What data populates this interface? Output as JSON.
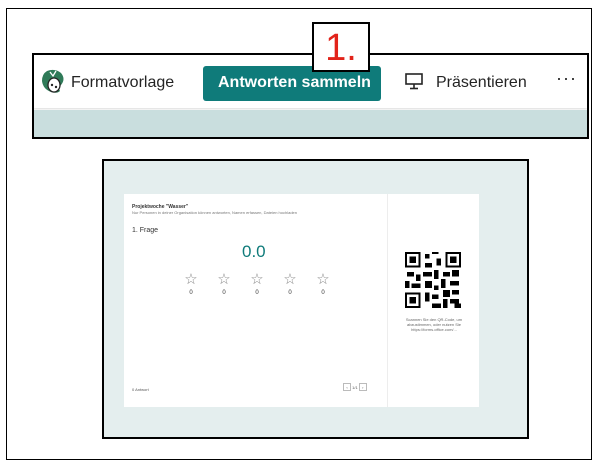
{
  "toolbar": {
    "style_label": "Formatvorlage",
    "collect_label": "Antworten sammeln",
    "step_number": "1.",
    "present_label": "Präsentieren",
    "more_label": "···"
  },
  "presentation": {
    "form_title": "Projektwoche \"Wasser\"",
    "form_subtitle": "Nur Personen in deiner Organisation können antworten, Namen erfassen, Dateien hochladen",
    "question_label": "1. Frage",
    "average_value": "0.0",
    "star_counts": [
      "0",
      "0",
      "0",
      "0",
      "0"
    ],
    "qr_caption": "Scannen Sie den QR-Code, um abzustimmen, oder nutzen Sie https://forms.office.com/...",
    "answers_count": "0 Antwort",
    "pager_label": "1/1"
  },
  "icons": {
    "style": "palette-icon",
    "present": "monitor-icon",
    "more": "more-icon",
    "star": "star-icon",
    "qr": "qr-code-icon"
  },
  "colors": {
    "accent": "#0f7b7a",
    "strip": "#c9dede",
    "callout_text": "#e2231a",
    "slide_background": "#e4eeee"
  }
}
